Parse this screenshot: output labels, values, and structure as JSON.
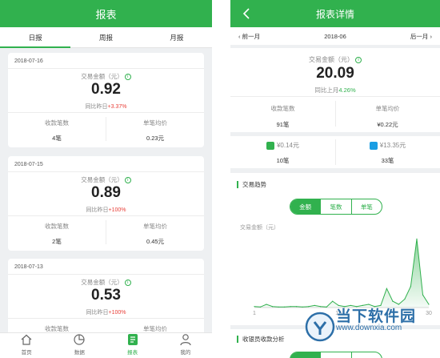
{
  "left": {
    "title": "报表",
    "tabs": [
      {
        "label": "日报",
        "active": true
      },
      {
        "label": "周报",
        "active": false
      },
      {
        "label": "月报",
        "active": false
      }
    ],
    "cards": [
      {
        "date": "2018-07-16",
        "amount_label": "交易金额（元）",
        "amount": "0.92",
        "compare_label": "同比昨日",
        "compare_value": "+3.37%",
        "count_label": "收款笔数",
        "count_value": "4笔",
        "avg_label": "单笔均价",
        "avg_value": "0.23元"
      },
      {
        "date": "2018-07-15",
        "amount_label": "交易金额（元）",
        "amount": "0.89",
        "compare_label": "同比昨日",
        "compare_value": "+100%",
        "count_label": "收款笔数",
        "count_value": "2笔",
        "avg_label": "单笔均价",
        "avg_value": "0.45元"
      },
      {
        "date": "2018-07-13",
        "amount_label": "交易金额（元）",
        "amount": "0.53",
        "compare_label": "同比昨日",
        "compare_value": "+100%",
        "count_label": "收款笔数",
        "count_value": "",
        "avg_label": "单笔均价",
        "avg_value": ""
      }
    ],
    "nav": [
      {
        "label": "首页",
        "icon": "home-icon",
        "active": false
      },
      {
        "label": "数据",
        "icon": "pie-chart-icon",
        "active": false
      },
      {
        "label": "报表",
        "icon": "report-icon",
        "active": true
      },
      {
        "label": "我的",
        "icon": "user-icon",
        "active": false
      }
    ]
  },
  "right": {
    "title": "报表详情",
    "prev_month": "‹ 前一月",
    "month": "2018-06",
    "next_month": "后一月 ›",
    "summary": {
      "amount_label": "交易金额（元）",
      "amount": "20.09",
      "compare_label": "同比上月",
      "compare_value": "4.26%",
      "count_label": "收款笔数",
      "count_value": "91笔",
      "avg_label": "单笔均价",
      "avg_value": "¥0.22元"
    },
    "pay": [
      {
        "icon": "wechat-icon",
        "amount": "¥0.14元",
        "count": "10笔"
      },
      {
        "icon": "alipay-icon",
        "amount": "¥13.35元",
        "count": "33笔"
      }
    ],
    "trend_title": "交易趋势",
    "segments": [
      {
        "label": "金额",
        "active": true
      },
      {
        "label": "笔数",
        "active": false
      },
      {
        "label": "单笔",
        "active": false
      }
    ],
    "staff_title": "收银员收款分析"
  },
  "chart_data": {
    "type": "area",
    "ylabel": "交易金额（元）",
    "x": [
      1,
      2,
      3,
      4,
      5,
      6,
      7,
      8,
      9,
      10,
      11,
      12,
      13,
      14,
      15,
      16,
      17,
      18,
      19,
      20,
      21,
      22,
      23,
      24,
      25,
      26,
      27,
      28,
      29,
      30
    ],
    "values": [
      0.1,
      0.05,
      0.3,
      0.1,
      0.05,
      0.05,
      0.1,
      0.1,
      0.05,
      0.1,
      0.2,
      0.1,
      0.05,
      0.6,
      0.2,
      0.1,
      0.2,
      0.1,
      0.2,
      0.3,
      0.1,
      0.2,
      1.8,
      0.6,
      0.3,
      0.8,
      2.0,
      6.5,
      1.2,
      0.3
    ],
    "xticks": [
      "1",
      "15",
      "30"
    ],
    "color": "#31b14e"
  },
  "watermark": {
    "text": "当下软件园",
    "url": "www.downxia.com"
  }
}
